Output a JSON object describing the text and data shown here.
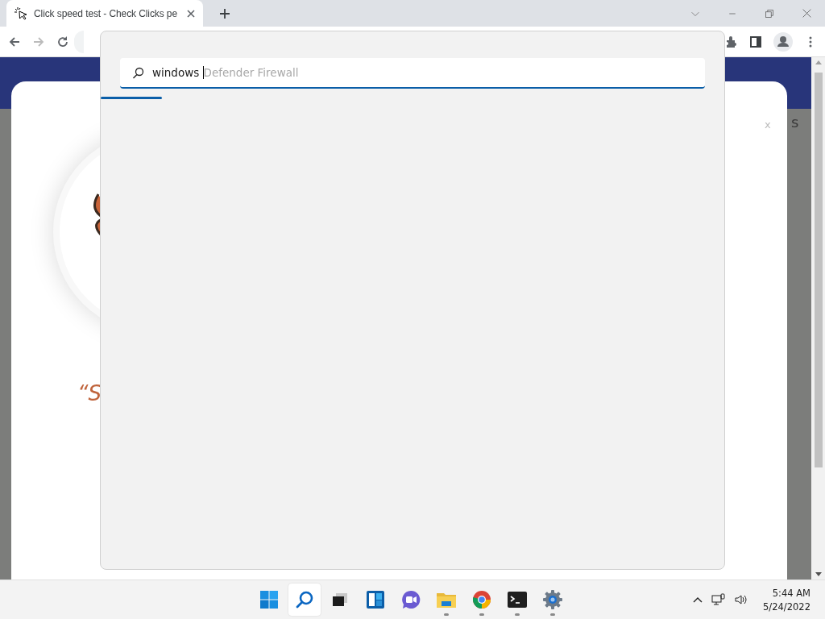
{
  "browser": {
    "tab": {
      "title": "Click speed test - Check Clicks pe",
      "selected": true
    },
    "toolbar": {
      "back_disabled": false,
      "forward_disabled": true
    }
  },
  "page": {
    "modal_close": "x",
    "side_text": "s",
    "quote": "“S"
  },
  "search_flyout": {
    "value": "windows ",
    "suggestion": "Defender Firewall"
  },
  "taskbar": {
    "items": [
      {
        "kind": "start",
        "selected": false,
        "running": false
      },
      {
        "kind": "search",
        "selected": true,
        "running": false
      },
      {
        "kind": "taskview",
        "selected": false,
        "running": false
      },
      {
        "kind": "widgets",
        "selected": false,
        "running": false
      },
      {
        "kind": "chat",
        "selected": false,
        "running": false
      },
      {
        "kind": "explorer",
        "selected": false,
        "running": true
      },
      {
        "kind": "chrome",
        "selected": false,
        "running": true
      },
      {
        "kind": "terminal",
        "selected": false,
        "running": true
      },
      {
        "kind": "settings",
        "selected": false,
        "running": true
      }
    ],
    "tray": {
      "time": "5:44 AM",
      "date": "5/24/2022"
    }
  }
}
